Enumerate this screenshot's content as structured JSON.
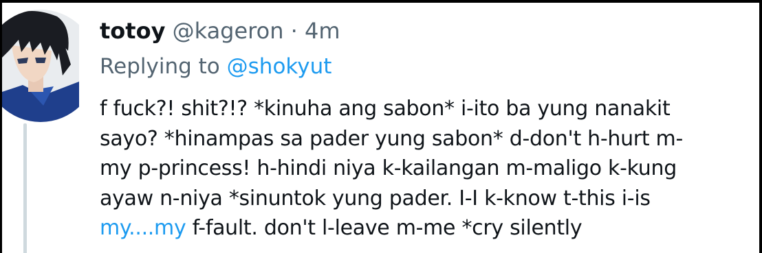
{
  "tweet": {
    "display_name": "totoy",
    "handle": "@kageron",
    "separator": "·",
    "time": "4m",
    "replying_prefix": "Replying to",
    "replying_to": "@shokyut",
    "body_lines": [
      "f fuck?! shit?!? *kinuha ang sabon* i-ito ba yung nanakit",
      "sayo? *hinampas sa pader yung sabon* d-don't h-hurt m-",
      "my p-princess! h-hindi niya k-kailangan m-maligo k-kung",
      "ayaw n-niya *sinuntok yung pader. I-I k-know t-this i-is"
    ],
    "last_line_link": "my....my",
    "last_line_rest": " f-fault. don't l-leave m-me *cry silently"
  },
  "avatar": {
    "icon": "anime-avatar-icon",
    "colors": {
      "hair": "#1a1c22",
      "skin": "#f1d7c4",
      "jacket": "#1f3f8c",
      "background": "#e9ecef"
    }
  },
  "colors": {
    "text": "#0f1419",
    "secondary": "#536471",
    "link": "#1d9bf0",
    "thread_line": "#cfd9de"
  }
}
